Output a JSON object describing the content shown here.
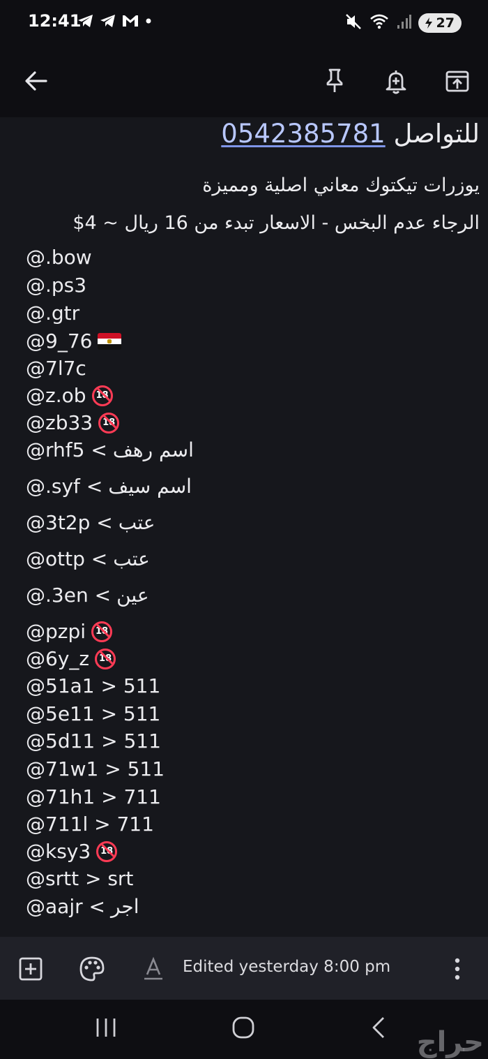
{
  "status_bar": {
    "time": "12:41",
    "battery": "27",
    "left_icons": [
      "telegram-icon",
      "telegram-icon",
      "gmail-icon",
      "dot-icon"
    ],
    "right_icons": [
      "mute-icon",
      "wifi-icon",
      "signal-icon",
      "battery-icon"
    ]
  },
  "toolbar": {
    "icons": [
      "back-arrow-icon",
      "pin-icon",
      "add-reminder-icon",
      "archive-icon"
    ]
  },
  "note": {
    "contact_label": "للتواصل",
    "phone": "0542385781",
    "subtitle": "يوزرات تيكتوك معاني اصلية ومميزة",
    "pricing": "الرجاء عدم البخس - الاسعار تبدء من 16 ريال ~ 4$",
    "items": [
      {
        "handle": "@.bow",
        "note": "",
        "tag": ""
      },
      {
        "handle": "@.ps3",
        "note": "",
        "tag": ""
      },
      {
        "handle": "@.gtr",
        "note": "",
        "tag": ""
      },
      {
        "handle": "@9_76",
        "note": "",
        "tag": "flag"
      },
      {
        "handle": "@7l7c",
        "note": "",
        "tag": ""
      },
      {
        "handle": "@z.ob",
        "note": "",
        "tag": "18"
      },
      {
        "handle": "@zb33",
        "note": "",
        "tag": "18"
      },
      {
        "handle": "@rhf5 <",
        "note": "اسم رهف",
        "tag": ""
      },
      {
        "handle": "@.syf <",
        "note": "اسم سيف",
        "tag": ""
      },
      {
        "handle": "@3t2p <",
        "note": "عتب",
        "tag": ""
      },
      {
        "handle": "@ottp <",
        "note": "عتب",
        "tag": ""
      },
      {
        "handle": "@.3en <",
        "note": "عين",
        "tag": ""
      },
      {
        "handle": "@pzpi",
        "note": "",
        "tag": "18"
      },
      {
        "handle": "@6y_z",
        "note": "",
        "tag": "18"
      },
      {
        "handle": "@51a1 > 511",
        "note": "",
        "tag": ""
      },
      {
        "handle": "@5e11 > 511",
        "note": "",
        "tag": ""
      },
      {
        "handle": "@5d11 > 511",
        "note": "",
        "tag": ""
      },
      {
        "handle": "@71w1 > 511",
        "note": "",
        "tag": ""
      },
      {
        "handle": "@71h1 > 711",
        "note": "",
        "tag": ""
      },
      {
        "handle": "@711l > 711",
        "note": "",
        "tag": ""
      },
      {
        "handle": "@ksy3",
        "note": "",
        "tag": "18"
      },
      {
        "handle": "@srtt > srt",
        "note": "",
        "tag": ""
      },
      {
        "handle": "@aajr <",
        "note": "اجر",
        "tag": ""
      }
    ]
  },
  "bottom_bar": {
    "edited": "Edited yesterday 8:00 pm",
    "icons": [
      "add-box-icon",
      "palette-icon",
      "text-format-icon",
      "more-vert-icon"
    ]
  },
  "nav_bar": {
    "icons": [
      "recents-icon",
      "home-icon",
      "back-icon"
    ]
  },
  "watermark": "حراج"
}
